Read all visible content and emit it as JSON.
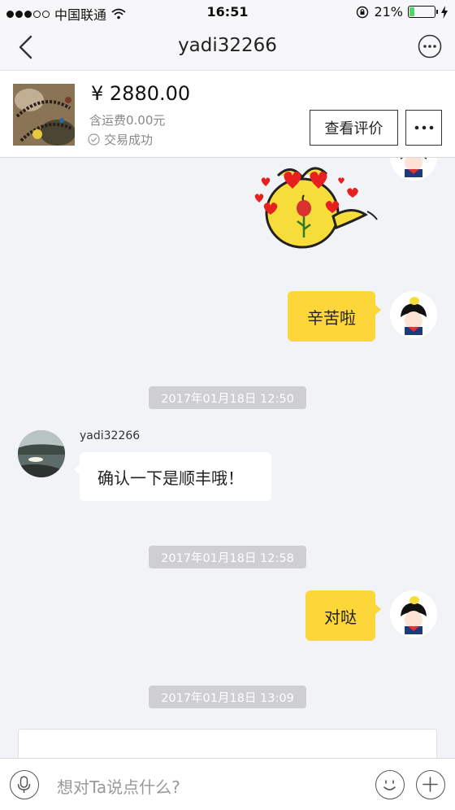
{
  "status_bar": {
    "carrier": "中国联通",
    "time": "16:51",
    "battery": "21%",
    "battery_level": 0.21
  },
  "nav": {
    "title": "yadi32266"
  },
  "product": {
    "price": "¥ 2880.00",
    "shipping": "含运费0.00元",
    "status": "交易成功",
    "review_button": "查看评价"
  },
  "chat": {
    "messages": [
      {
        "type": "sticker",
        "from": "me"
      },
      {
        "type": "text",
        "from": "me",
        "text": "辛苦啦"
      },
      {
        "type": "timestamp",
        "text": "2017年01月18日 12:50"
      },
      {
        "type": "text",
        "from": "them",
        "sender": "yadi32266",
        "text": "确认一下是顺丰哦！"
      },
      {
        "type": "timestamp",
        "text": "2017年01月18日 12:58"
      },
      {
        "type": "text",
        "from": "me",
        "text": "对哒"
      },
      {
        "type": "timestamp",
        "text": "2017年01月18日 13:09"
      }
    ]
  },
  "input": {
    "placeholder": "想对Ta说点什么?"
  },
  "colors": {
    "bubble_me": "#fdd63a",
    "background": "#f2f3f7",
    "timestamp_bg": "#cfcfd3"
  }
}
